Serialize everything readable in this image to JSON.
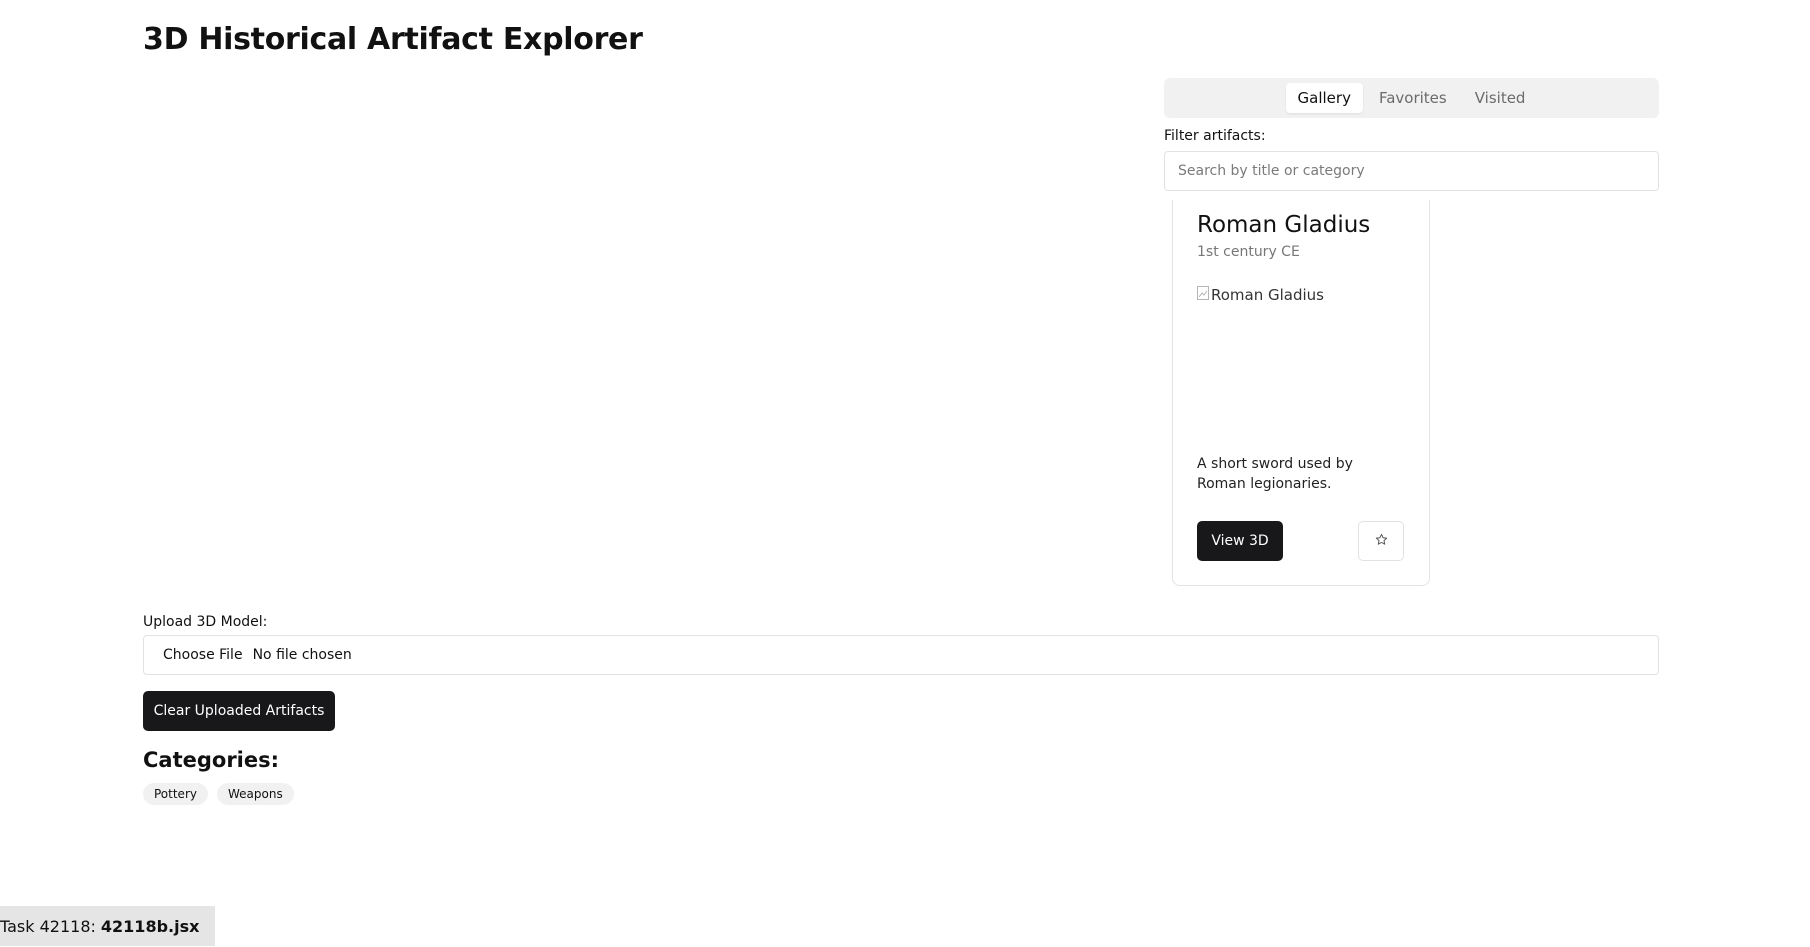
{
  "app": {
    "title": "3D Historical Artifact Explorer"
  },
  "tabs": [
    {
      "label": "Gallery",
      "active": true
    },
    {
      "label": "Favorites",
      "active": false
    },
    {
      "label": "Visited",
      "active": false
    }
  ],
  "filter": {
    "label": "Filter artifacts:",
    "placeholder": "Search by title or category",
    "value": ""
  },
  "artifact": {
    "title": "Roman Gladius",
    "date": "1st century CE",
    "image_alt": "Roman Gladius",
    "description": "A short sword used by Roman legionaries.",
    "view_label": "View 3D",
    "favorite_icon": "star-outline-icon"
  },
  "upload": {
    "label": "Upload 3D Model:",
    "choose_label": "Choose File",
    "status": "No file chosen"
  },
  "clear_label": "Clear Uploaded Artifacts",
  "categories": {
    "heading": "Categories:",
    "items": [
      "Pottery",
      "Weapons"
    ]
  },
  "task": {
    "prefix": "Task 42118:",
    "file": "42118b.jsx"
  },
  "colors": {
    "primary_button": "#18181b",
    "tab_bar": "#f1f1f2",
    "border": "#e2e2e5"
  }
}
